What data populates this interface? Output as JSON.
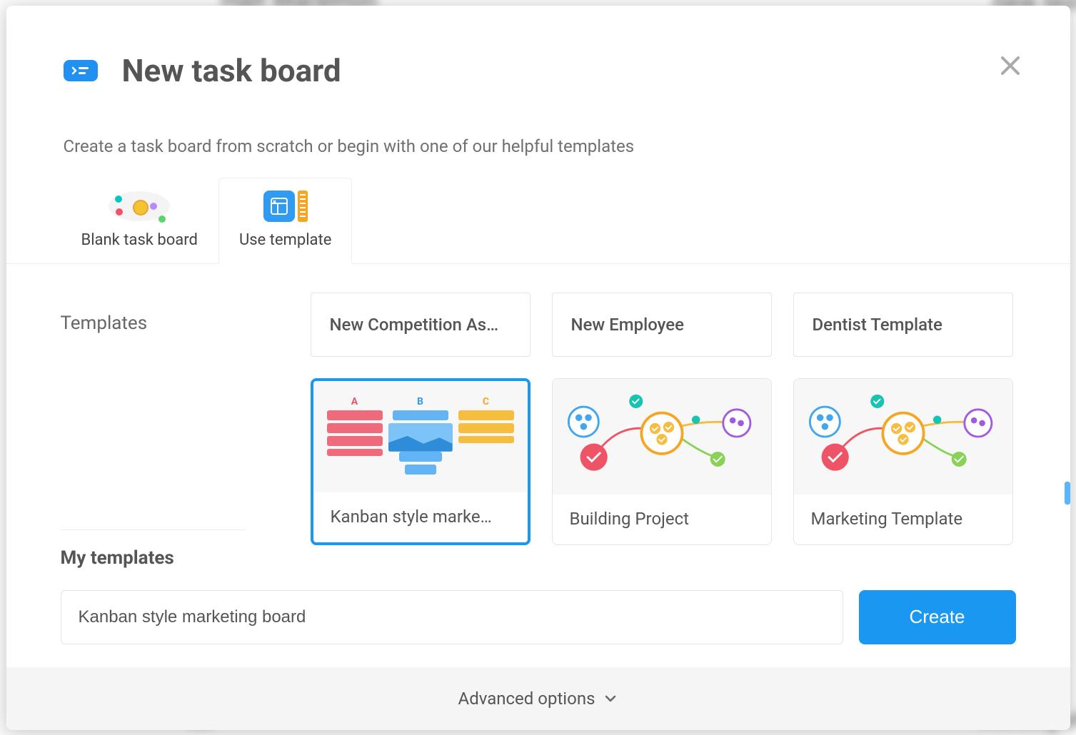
{
  "header": {
    "title": "New task board",
    "subtitle": "Create a task board from scratch or begin with one of our helpful templates"
  },
  "tabs": {
    "blank": "Blank task board",
    "use_template": "Use template"
  },
  "sections": {
    "templates": "Templates",
    "my_templates": "My templates"
  },
  "templates_row1": [
    {
      "label": "New Competition As…"
    },
    {
      "label": "New Employee"
    },
    {
      "label": "Dentist Template"
    }
  ],
  "templates_row2": [
    {
      "label": "Kanban style marke…",
      "selected": true,
      "kind": "kanban"
    },
    {
      "label": "Building Project",
      "selected": false,
      "kind": "nodes"
    },
    {
      "label": "Marketing Template",
      "selected": false,
      "kind": "nodes"
    }
  ],
  "form": {
    "name_value": "Kanban style marketing board",
    "create_label": "Create"
  },
  "footer": {
    "advanced": "Advanced options"
  },
  "colors": {
    "accent": "#1a97f0"
  }
}
